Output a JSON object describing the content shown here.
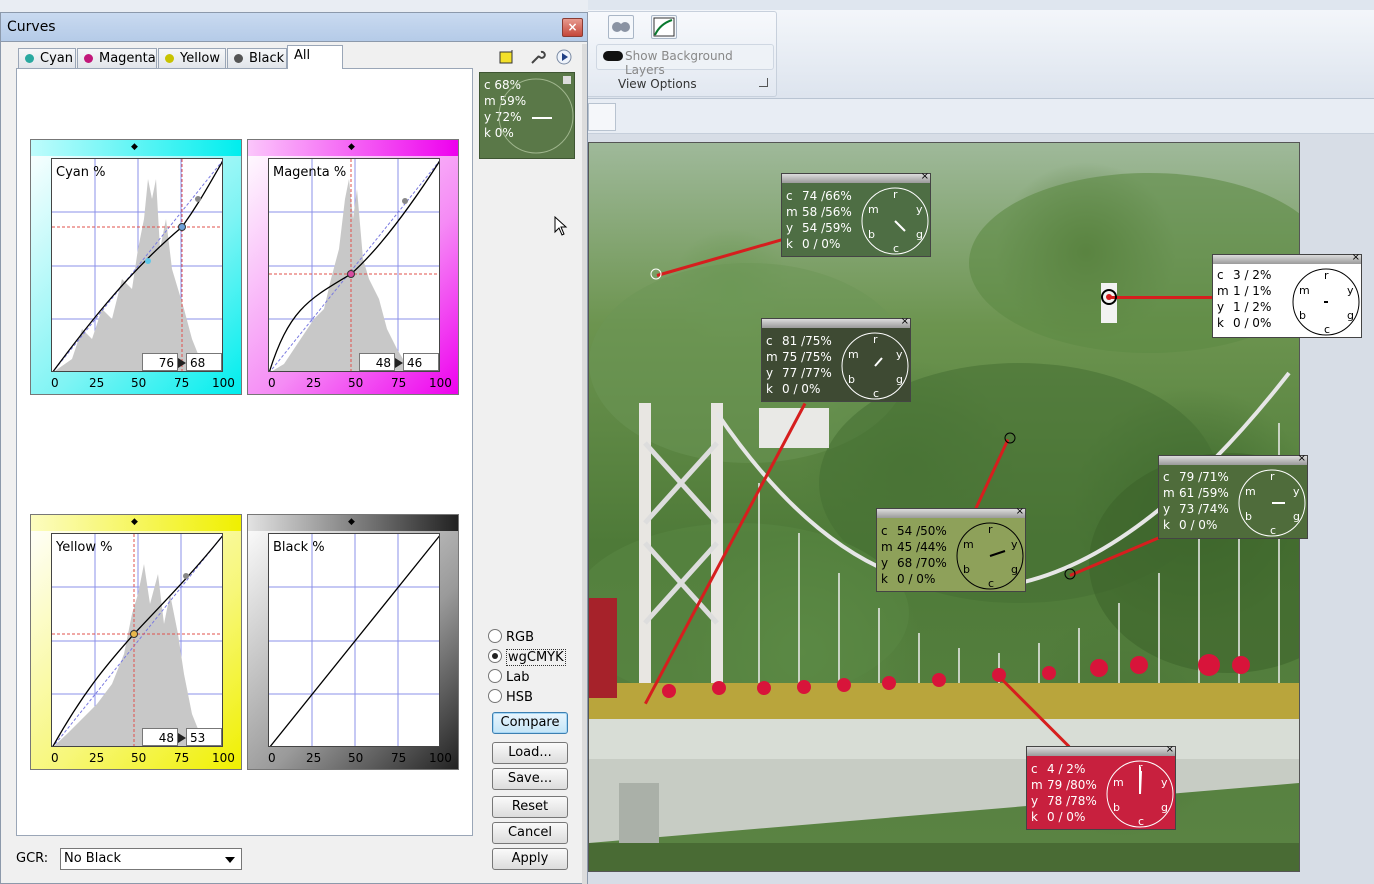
{
  "dialog": {
    "title": "Curves",
    "close_label": "×",
    "tabs": [
      "Cyan",
      "Magenta",
      "Yellow",
      "Black",
      "All"
    ],
    "tab_dot_colors": [
      "#2aa9a0",
      "#c2187a",
      "#c8c300",
      "#555555"
    ],
    "graphs": {
      "cyan": {
        "label": "Cyan %",
        "in": "76",
        "out": "68",
        "ticks": [
          "0",
          "25",
          "50",
          "75",
          "100"
        ]
      },
      "magenta": {
        "label": "Magenta %",
        "in": "48",
        "out": "46",
        "ticks": [
          "0",
          "25",
          "50",
          "75",
          "100"
        ]
      },
      "yellow": {
        "label": "Yellow %",
        "in": "48",
        "out": "53",
        "ticks": [
          "0",
          "25",
          "50",
          "75",
          "100"
        ]
      },
      "black": {
        "label": "Black %",
        "ticks": [
          "0",
          "25",
          "50",
          "75",
          "100"
        ]
      }
    },
    "color_modes": [
      "RGB",
      "wgCMYK",
      "Lab",
      "HSB"
    ],
    "selected_mode": "wgCMYK",
    "buttons": {
      "compare": "Compare",
      "load": "Load...",
      "save": "Save...",
      "reset": "Reset",
      "cancel": "Cancel",
      "apply": "Apply"
    },
    "gcr": {
      "label": "GCR:",
      "value": "No Black"
    },
    "preview": {
      "c": "c  68%",
      "m": "m 59%",
      "y": "y  72%",
      "k": "k  0%"
    }
  },
  "ribbon": {
    "show_background_layers": "Show Background Layers",
    "group_label": "View Options"
  },
  "readouts": [
    {
      "id": "readout-1",
      "c": "74 /66%",
      "m": "58 /56%",
      "y": "54 /59%",
      "k": "0 / 0%",
      "bg": "#4e6e44"
    },
    {
      "id": "readout-2",
      "c": "3 / 2%",
      "m": "1 / 1%",
      "y": "1 / 2%",
      "k": "0 / 0%",
      "bg": "#ffffff"
    },
    {
      "id": "readout-3",
      "c": "81 /75%",
      "m": "75 /75%",
      "y": "77 /77%",
      "k": "0 / 0%",
      "bg": "#3e4a33"
    },
    {
      "id": "readout-4",
      "c": "79 /71%",
      "m": "61 /59%",
      "y": "73 /74%",
      "k": "0 / 0%",
      "bg": "#4f6c3b"
    },
    {
      "id": "readout-5",
      "c": "54 /50%",
      "m": "45 /44%",
      "y": "68 /70%",
      "k": "0 / 0%",
      "bg": "#8ea15a"
    },
    {
      "id": "readout-6",
      "c": "4 / 2%",
      "m": "79 /80%",
      "y": "78 /78%",
      "k": "0 / 0%",
      "bg": "#c8203e"
    }
  ],
  "readout_letters": {
    "c": "c",
    "m": "m",
    "y": "y",
    "k": "k",
    "cl_m": "m",
    "cl_r": "r",
    "cl_y": "y",
    "cl_b": "b",
    "cl_c": "c",
    "cl_g": "g"
  }
}
